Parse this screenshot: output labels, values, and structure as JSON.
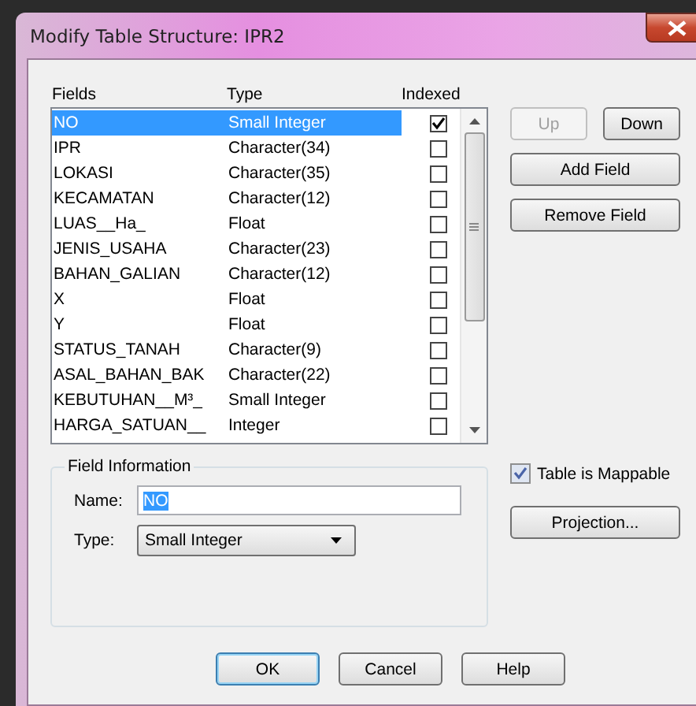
{
  "window": {
    "title": "Modify Table Structure: IPR2"
  },
  "columns": [
    "Fields",
    "Type",
    "Indexed"
  ],
  "rows": [
    {
      "name": "NO",
      "type": "Small Integer",
      "indexed": true,
      "selected": true
    },
    {
      "name": "IPR",
      "type": "Character(34)",
      "indexed": false,
      "selected": false
    },
    {
      "name": "LOKASI",
      "type": "Character(35)",
      "indexed": false,
      "selected": false
    },
    {
      "name": "KECAMATAN",
      "type": "Character(12)",
      "indexed": false,
      "selected": false
    },
    {
      "name": "LUAS__Ha_",
      "type": "Float",
      "indexed": false,
      "selected": false
    },
    {
      "name": "JENIS_USAHA",
      "type": "Character(23)",
      "indexed": false,
      "selected": false
    },
    {
      "name": "BAHAN_GALIAN",
      "type": "Character(12)",
      "indexed": false,
      "selected": false
    },
    {
      "name": "X",
      "type": "Float",
      "indexed": false,
      "selected": false
    },
    {
      "name": "Y",
      "type": "Float",
      "indexed": false,
      "selected": false
    },
    {
      "name": "STATUS_TANAH",
      "type": "Character(9)",
      "indexed": false,
      "selected": false
    },
    {
      "name": "ASAL_BAHAN_BAK",
      "type": "Character(22)",
      "indexed": false,
      "selected": false
    },
    {
      "name": "KEBUTUHAN__M³_",
      "type": "Small Integer",
      "indexed": false,
      "selected": false
    },
    {
      "name": "HARGA_SATUAN__",
      "type": "Integer",
      "indexed": false,
      "selected": false
    }
  ],
  "move_buttons": [
    {
      "label": "Up",
      "disabled": true
    },
    {
      "label": "Down",
      "disabled": false
    }
  ],
  "field_buttons": [
    {
      "label": "Add Field",
      "disabled": false
    },
    {
      "label": "Remove Field",
      "disabled": false
    }
  ],
  "field_information": {
    "title": "Field Information",
    "name_label": "Name:",
    "name_value": "NO",
    "type_label": "Type:",
    "type_value": "Small Integer"
  },
  "mappable": {
    "label": "Table is Mappable",
    "checked": true
  },
  "projection_button": {
    "label": "Projection..."
  },
  "dialog_buttons": [
    {
      "label": "OK",
      "default": true
    },
    {
      "label": "Cancel",
      "default": false
    },
    {
      "label": "Help",
      "default": false
    }
  ]
}
